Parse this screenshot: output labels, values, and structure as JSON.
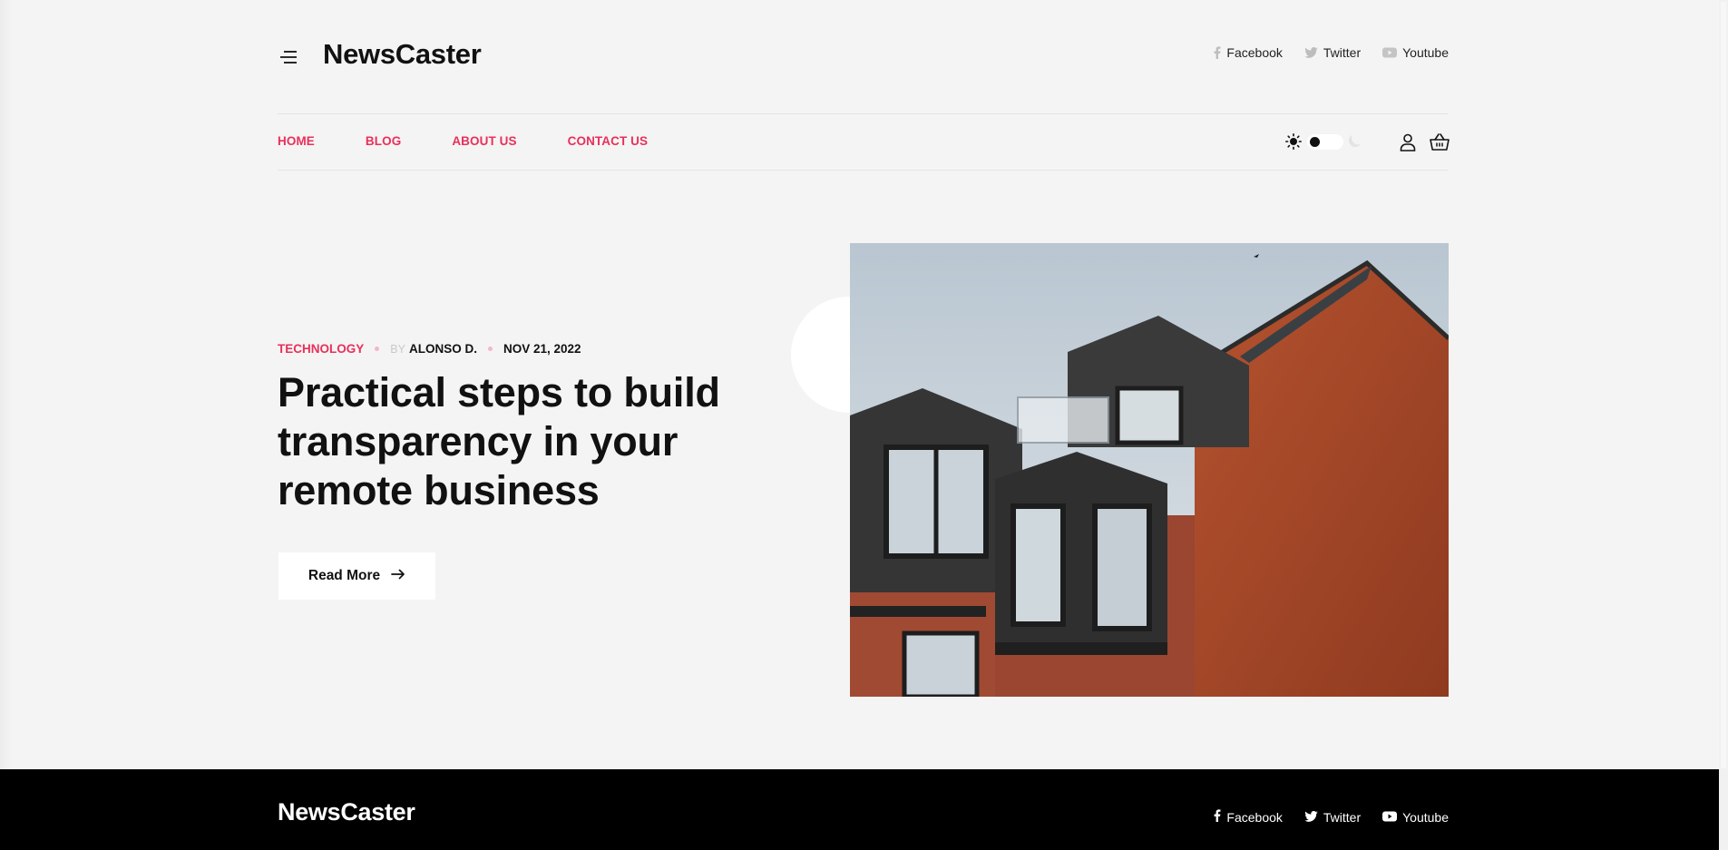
{
  "header": {
    "logo": "NewsCaster",
    "social": [
      {
        "label": "Facebook",
        "icon": "facebook-icon"
      },
      {
        "label": "Twitter",
        "icon": "twitter-icon"
      },
      {
        "label": "Youtube",
        "icon": "youtube-icon"
      }
    ]
  },
  "nav": {
    "items": [
      "HOME",
      "BLOG",
      "ABOUT US",
      "CONTACT US"
    ]
  },
  "theme": {
    "accent": "#e8305a",
    "mode": "light"
  },
  "article": {
    "category": "TECHNOLOGY",
    "by_label": "BY",
    "author": "ALONSO D.",
    "date": "NOV 21, 2022",
    "headline": "Practical steps to build transparency in your remote business",
    "read_more": "Read More"
  },
  "footer": {
    "logo": "NewsCaster",
    "social": [
      {
        "label": "Facebook",
        "icon": "facebook-icon"
      },
      {
        "label": "Twitter",
        "icon": "twitter-icon"
      },
      {
        "label": "Youtube",
        "icon": "youtube-icon"
      }
    ]
  }
}
